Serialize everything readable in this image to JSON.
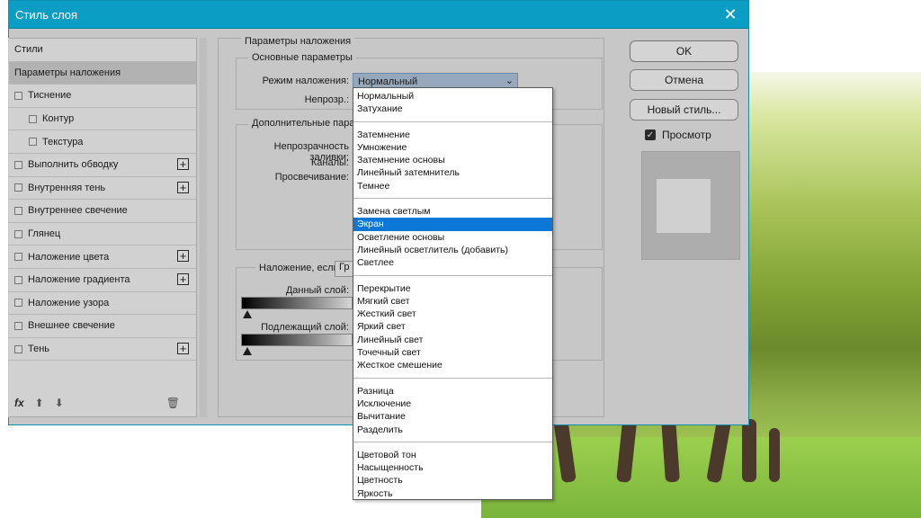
{
  "dialog": {
    "title": "Стиль слоя",
    "close_icon": "close-icon"
  },
  "styles_list": {
    "header": "Стили",
    "items": [
      {
        "label": "Параметры наложения",
        "checkbox": false,
        "plus": false,
        "selected": true,
        "indent": false
      },
      {
        "label": "Тиснение",
        "checkbox": true,
        "plus": false,
        "selected": false,
        "indent": false
      },
      {
        "label": "Контур",
        "checkbox": true,
        "plus": false,
        "selected": false,
        "indent": true
      },
      {
        "label": "Текстура",
        "checkbox": true,
        "plus": false,
        "selected": false,
        "indent": true
      },
      {
        "label": "Выполнить обводку",
        "checkbox": true,
        "plus": true,
        "selected": false,
        "indent": false
      },
      {
        "label": "Внутренняя тень",
        "checkbox": true,
        "plus": true,
        "selected": false,
        "indent": false
      },
      {
        "label": "Внутреннее свечение",
        "checkbox": true,
        "plus": false,
        "selected": false,
        "indent": false
      },
      {
        "label": "Глянец",
        "checkbox": true,
        "plus": false,
        "selected": false,
        "indent": false
      },
      {
        "label": "Наложение цвета",
        "checkbox": true,
        "plus": true,
        "selected": false,
        "indent": false
      },
      {
        "label": "Наложение градиента",
        "checkbox": true,
        "plus": true,
        "selected": false,
        "indent": false
      },
      {
        "label": "Наложение узора",
        "checkbox": true,
        "plus": false,
        "selected": false,
        "indent": false
      },
      {
        "label": "Внешнее свечение",
        "checkbox": true,
        "plus": false,
        "selected": false,
        "indent": false
      },
      {
        "label": "Тень",
        "checkbox": true,
        "plus": true,
        "selected": false,
        "indent": false
      }
    ],
    "footer_fx": "fx"
  },
  "blending": {
    "section_title": "Параметры наложения",
    "basic_title": "Основные параметры",
    "blend_mode_label": "Режим наложения:",
    "blend_mode_value": "Нормальный",
    "opacity_label": "Непрозр.:",
    "advanced_title": "Дополнительные параметры",
    "fill_opacity_label": "Непрозрачность заливки:",
    "channels_label": "Каналы:",
    "knockout_label": "Просвечивание:",
    "blend_if_label": "Наложение, если:",
    "blend_if_value": "Гр",
    "this_layer_label": "Данный слой:",
    "underlying_label": "Подлежащий слой:"
  },
  "buttons": {
    "ok": "OK",
    "cancel": "Отмена",
    "new_style": "Новый стиль...",
    "preview_label": "Просмотр"
  },
  "dropdown": {
    "groups": [
      [
        "Нормальный",
        "Затухание"
      ],
      [
        "Затемнение",
        "Умножение",
        "Затемнение основы",
        "Линейный затемнитель",
        "Темнее"
      ],
      [
        "Замена светлым",
        "Экран",
        "Осветление основы",
        "Линейный осветлитель (добавить)",
        "Светлее"
      ],
      [
        "Перекрытие",
        "Мягкий свет",
        "Жесткий свет",
        "Яркий свет",
        "Линейный свет",
        "Точечный свет",
        "Жесткое смешение"
      ],
      [
        "Разница",
        "Исключение",
        "Вычитание",
        "Разделить"
      ],
      [
        "Цветовой тон",
        "Насыщенность",
        "Цветность",
        "Яркость"
      ]
    ],
    "selected": "Экран"
  },
  "colors": {
    "titlebar": "#0b9ec4",
    "selection": "#0b78d7"
  }
}
